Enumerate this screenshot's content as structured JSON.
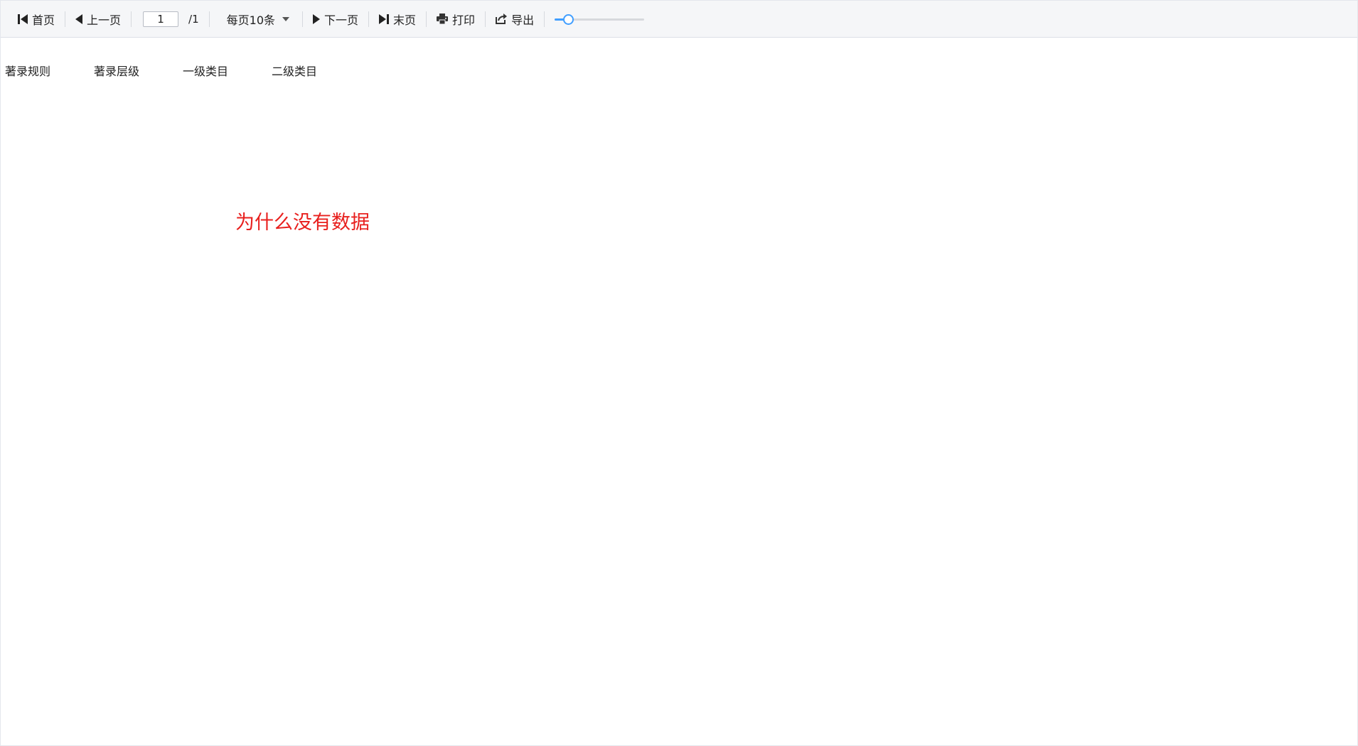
{
  "toolbar": {
    "first_label": "首页",
    "prev_label": "上一页",
    "page_value": "1",
    "page_total": "/1",
    "page_size_label": "每页10条",
    "next_label": "下一页",
    "last_label": "末页",
    "print_label": "打印",
    "export_label": "导出",
    "zoom_level": 0.15,
    "accent_color": "#409eff"
  },
  "table": {
    "columns": [
      "著录规则",
      "著录层级",
      "一级类目",
      "二级类目"
    ]
  },
  "message": {
    "text": "为什么没有数据",
    "color": "#e8201e"
  },
  "icons": [
    "first-page-icon",
    "prev-page-icon",
    "dropdown-caret-icon",
    "next-page-icon",
    "last-page-icon",
    "print-icon",
    "export-icon"
  ]
}
